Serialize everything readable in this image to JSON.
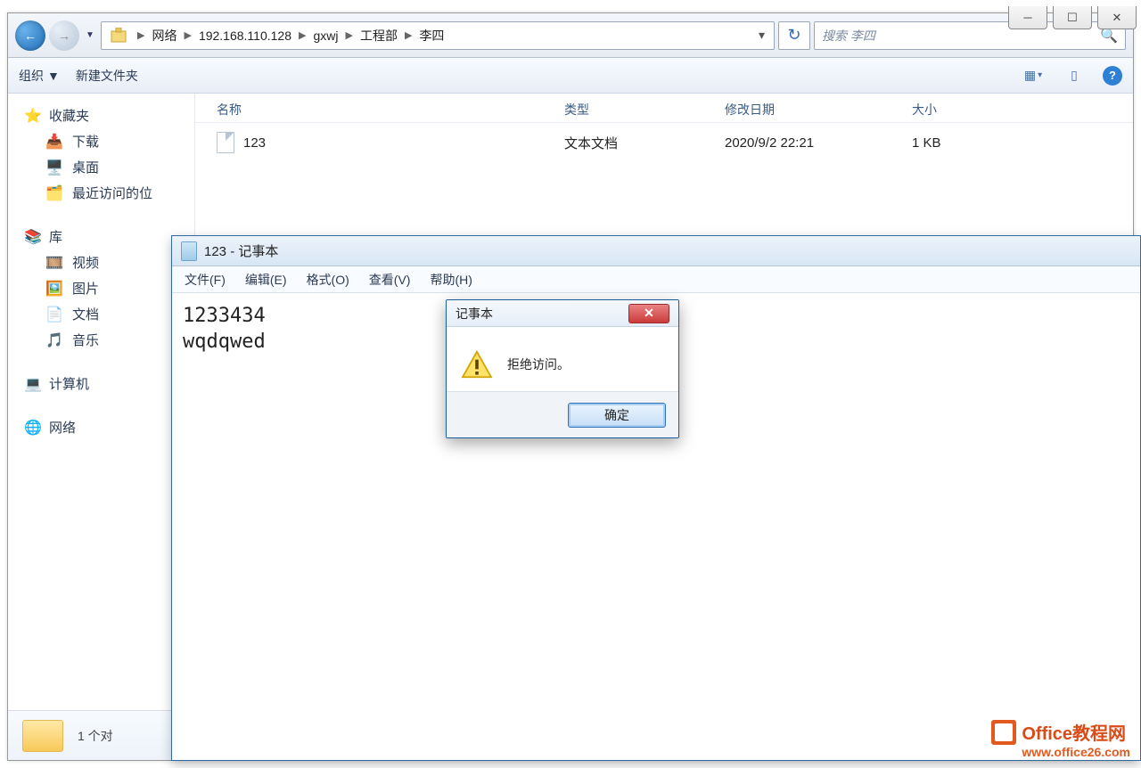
{
  "window_controls": {
    "min": "─",
    "max": "☐",
    "close": "✕"
  },
  "nav": {
    "back": "←",
    "fwd": "→",
    "drop": "▼",
    "crumbs": [
      "网络",
      "192.168.110.128",
      "gxwj",
      "工程部",
      "李四"
    ],
    "refresh": "↻",
    "search_placeholder": "搜索 李四"
  },
  "toolbar": {
    "organize": "组织",
    "org_arr": "▼",
    "new_folder": "新建文件夹",
    "view": "▦",
    "viewarr": "▾",
    "pane": "▯",
    "help": "?"
  },
  "columns": {
    "name": "名称",
    "type": "类型",
    "date": "修改日期",
    "size": "大小"
  },
  "file": {
    "name": "123",
    "type": "文本文档",
    "date": "2020/9/2 22:21",
    "size": "1 KB"
  },
  "sidebar": {
    "fav": "收藏夹",
    "downloads": "下载",
    "desktop": "桌面",
    "recent": "最近访问的位",
    "lib": "库",
    "videos": "视频",
    "pictures": "图片",
    "docs": "文档",
    "music": "音乐",
    "computer": "计算机",
    "network": "网络"
  },
  "status": "1 个对",
  "notepad": {
    "title": "123 - 记事本",
    "menu": {
      "file": "文件(F)",
      "edit": "编辑(E)",
      "format": "格式(O)",
      "view": "查看(V)",
      "help": "帮助(H)"
    },
    "content": "1233434\nwqdqwed"
  },
  "dialog": {
    "title": "记事本",
    "message": "拒绝访问。",
    "ok": "确定",
    "close": "✕"
  },
  "watermark": {
    "line1": "Office教程网",
    "line2": "www.office26.com"
  }
}
